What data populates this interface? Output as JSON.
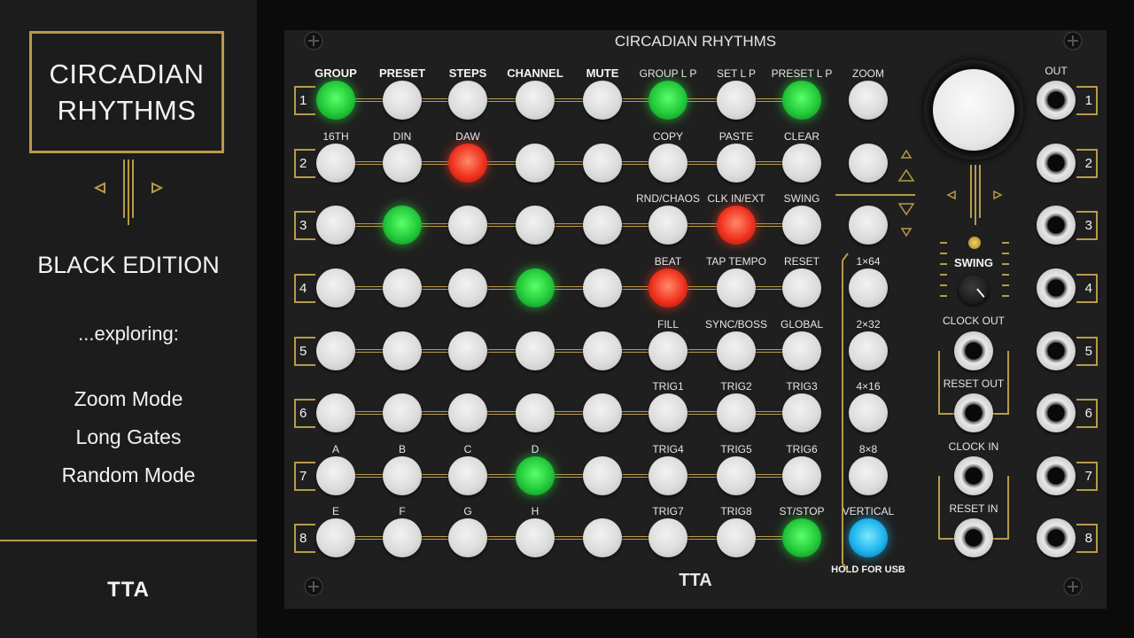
{
  "sidebar": {
    "title_line1": "CIRCADIAN",
    "title_line2": "RHYTHMS",
    "edition": "BLACK EDITION",
    "exploring": "...exploring:",
    "topics": [
      "Zoom Mode",
      "Long Gates",
      "Random Mode"
    ],
    "logo": "TTA"
  },
  "panel": {
    "title": "CIRCADIAN RHYTHMS",
    "logo": "TTA",
    "top_labels": [
      "GROUP",
      "PRESET",
      "STEPS",
      "CHANNEL",
      "MUTE",
      "GROUP L P",
      "SET L P",
      "PRESET L P"
    ],
    "row_labels": [
      [],
      [
        "16TH",
        "DIN",
        "DAW",
        "",
        "",
        "COPY",
        "PASTE",
        "CLEAR"
      ],
      [
        "",
        "",
        "",
        "",
        "",
        "RND/CHAOS",
        "CLK IN/EXT",
        "SWING"
      ],
      [
        "",
        "",
        "",
        "",
        "",
        "BEAT",
        "TAP TEMPO",
        "RESET"
      ],
      [
        "",
        "",
        "",
        "",
        "",
        "FILL",
        "SYNC/BOSS",
        "GLOBAL"
      ],
      [
        "",
        "",
        "",
        "",
        "",
        "TRIG1",
        "TRIG2",
        "TRIG3"
      ],
      [
        "A",
        "B",
        "C",
        "D",
        "",
        "TRIG4",
        "TRIG5",
        "TRIG6"
      ],
      [
        "E",
        "F",
        "G",
        "H",
        "",
        "TRIG7",
        "TRIG8",
        "ST/STOP"
      ]
    ],
    "row_numbers": [
      "1",
      "2",
      "3",
      "4",
      "5",
      "6",
      "7",
      "8"
    ],
    "grid_state": [
      [
        "green",
        "off",
        "off",
        "off",
        "off",
        "green",
        "off",
        "green"
      ],
      [
        "off",
        "off",
        "red",
        "off",
        "off",
        "off",
        "off",
        "off"
      ],
      [
        "off",
        "green",
        "off",
        "off",
        "off",
        "off",
        "red",
        "off"
      ],
      [
        "off",
        "off",
        "off",
        "green",
        "off",
        "red",
        "off",
        "off"
      ],
      [
        "off",
        "off",
        "off",
        "off",
        "off",
        "off",
        "off",
        "off"
      ],
      [
        "off",
        "off",
        "off",
        "off",
        "off",
        "off",
        "off",
        "off"
      ],
      [
        "off",
        "off",
        "off",
        "green",
        "off",
        "off",
        "off",
        "off"
      ],
      [
        "off",
        "off",
        "off",
        "off",
        "off",
        "off",
        "off",
        "green"
      ]
    ],
    "zoom_column": {
      "labels": [
        "ZOOM",
        "",
        "",
        "1×64",
        "2×32",
        "4×16",
        "8×8",
        "VERTICAL"
      ],
      "state": [
        "off",
        "off",
        "off",
        "off",
        "off",
        "off",
        "off",
        "blue"
      ],
      "hold_label": "HOLD FOR USB"
    },
    "swing_label": "SWING",
    "clock_out": "CLOCK OUT",
    "reset_out": "RESET OUT",
    "clock_in": "CLOCK IN",
    "reset_in": "RESET IN",
    "out_label": "OUT",
    "out_numbers": [
      "1",
      "2",
      "3",
      "4",
      "5",
      "6",
      "7",
      "8"
    ]
  },
  "colors": {
    "accent_gold": "#b89a4a",
    "led_green": "#22c93a",
    "led_red": "#f0321e",
    "led_blue": "#1eb4ee"
  }
}
